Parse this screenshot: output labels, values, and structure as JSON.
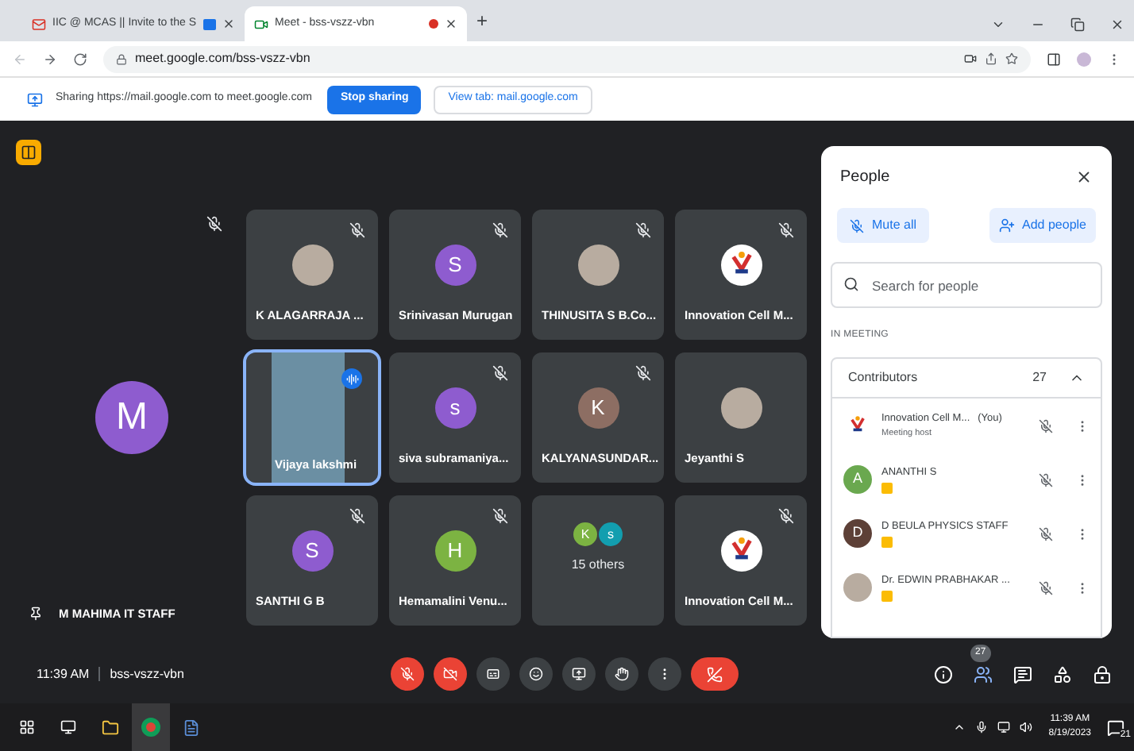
{
  "browser": {
    "tabs": [
      {
        "kind": "mail",
        "title": "IIC @ MCAS || Invite to the S",
        "recording": false,
        "selected": false
      },
      {
        "kind": "meet",
        "title": "Meet - bss-vszz-vbn",
        "recording": true,
        "selected": true
      }
    ],
    "new_tab": "+",
    "url": "meet.google.com/bss-vszz-vbn"
  },
  "sharing_bar": {
    "text": "Sharing https://mail.google.com to meet.google.com",
    "stop_button": "Stop sharing",
    "view_button": "View tab: mail.google.com"
  },
  "pinned": {
    "letter": "M",
    "color": "#8e5ccf",
    "name": "M MAHIMA IT STAFF",
    "muted": true
  },
  "tiles": [
    {
      "kind": "photo",
      "name": "K ALAGARRAJA ...",
      "muted": true,
      "selected": false
    },
    {
      "kind": "letter",
      "letter": "S",
      "color": "#8e5ccf",
      "name": "Srinivasan Murugan",
      "muted": true,
      "selected": false
    },
    {
      "kind": "photo",
      "name": "THINUSITA S B.Co...",
      "muted": true,
      "selected": false
    },
    {
      "kind": "logo",
      "name": "Innovation Cell M...",
      "muted": true,
      "selected": false
    },
    {
      "kind": "video",
      "name": "Vijaya lakshmi",
      "muted": false,
      "selected": true
    },
    {
      "kind": "letter",
      "letter": "s",
      "color": "#8e5ccf",
      "name": "siva subramaniya...",
      "muted": true,
      "selected": false
    },
    {
      "kind": "letter",
      "letter": "K",
      "color": "#8d6e63",
      "name": "KALYANASUNDAR...",
      "muted": true,
      "selected": false
    },
    {
      "kind": "photo",
      "name": "Jeyanthi S",
      "muted": false,
      "selected": false
    },
    {
      "kind": "letter",
      "letter": "S",
      "color": "#8e5ccf",
      "name": "SANTHI G B",
      "muted": true,
      "selected": false
    },
    {
      "kind": "letter",
      "letter": "H",
      "color": "#7cb342",
      "name": "Hemamalini Venu...",
      "muted": true,
      "selected": false
    },
    {
      "kind": "others",
      "avatars": [
        {
          "letter": "K",
          "color": "#7cb342"
        },
        {
          "letter": "s",
          "color": "#129eaf"
        }
      ],
      "name": "15 others",
      "muted": false,
      "selected": false
    },
    {
      "kind": "logo",
      "name": "Innovation Cell M...",
      "muted": true,
      "selected": false
    }
  ],
  "people": {
    "title": "People",
    "mute_all": "Mute all",
    "add_people": "Add people",
    "search_placeholder": "Search for people",
    "section": "IN MEETING",
    "group": {
      "label": "Contributors",
      "count": "27",
      "expanded": true
    },
    "members": [
      {
        "kind": "logo",
        "name": "Innovation Cell M...",
        "tag": "(You)",
        "role": "Meeting host",
        "badge": false
      },
      {
        "kind": "letter",
        "letter": "A",
        "color": "#6aa84f",
        "name": "ANANTHI S",
        "badge": true
      },
      {
        "kind": "letter",
        "letter": "D",
        "color": "#5d4037",
        "name": "D BEULA PHYSICS STAFF",
        "badge": true
      },
      {
        "kind": "photo",
        "name": "Dr. EDWIN PRABHAKAR ...",
        "badge": true
      }
    ]
  },
  "bottom_bar": {
    "time": "11:39 AM",
    "code": "bss-vszz-vbn",
    "mic_on": false,
    "camera_on": false,
    "people_count": "27"
  },
  "taskbar": {
    "time": "11:39 AM",
    "date": "8/19/2023",
    "notifications": "21"
  }
}
